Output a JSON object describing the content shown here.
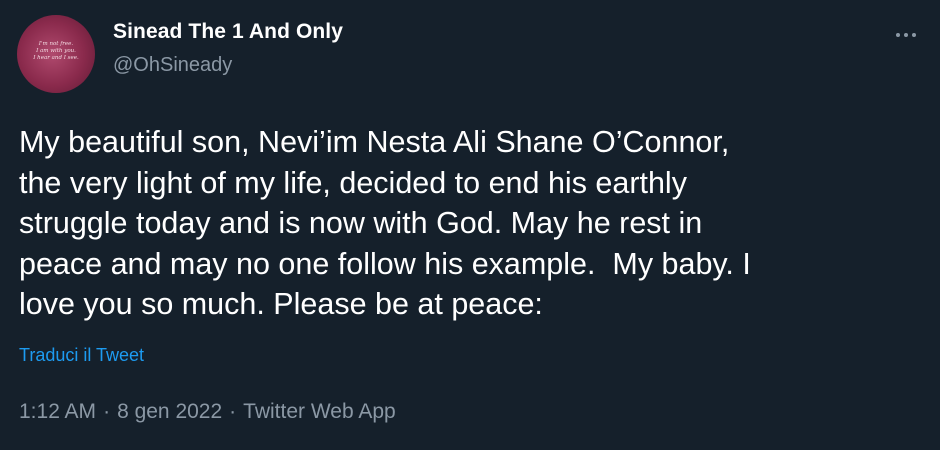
{
  "author": {
    "display_name": "Sinead The 1 And Only",
    "handle": "@OhSineady",
    "avatar_text": "I'm not free.\nI am with you.\nI hear and I see."
  },
  "tweet": {
    "text": "My beautiful son, Nevi’im Nesta Ali Shane O’Connor,\nthe very light of my life, decided to end his earthly\nstruggle today and is now with God. May he rest in\npeace and may no one follow his example.  My baby. I\nlove you so much. Please be at peace:",
    "translate_label": "Traduci il Tweet",
    "time": "1:12 AM",
    "date": "8 gen 2022",
    "source": "Twitter Web App",
    "separator": "·"
  },
  "icons": {
    "more": "more-horizontal-icon"
  },
  "colors": {
    "background": "#15202b",
    "text_primary": "#ffffff",
    "text_secondary": "#8b98a5",
    "link": "#1d9bf0",
    "avatar": "#8a2a4c"
  }
}
